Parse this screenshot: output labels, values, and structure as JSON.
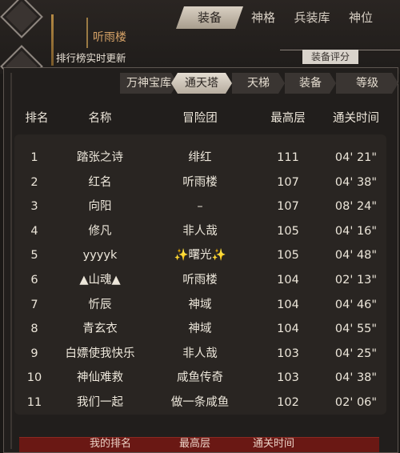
{
  "header": {
    "guild_name": "听雨楼",
    "rank_live_text": "排行榜实时更新",
    "score_button": "装备评分",
    "tabs": [
      {
        "label": "装备",
        "active": true
      },
      {
        "label": "神格",
        "active": false
      },
      {
        "label": "兵装库",
        "active": false
      },
      {
        "label": "神位",
        "active": false
      }
    ]
  },
  "subtabs": [
    {
      "label": "万神宝库",
      "active": false
    },
    {
      "label": "通天塔",
      "active": true
    },
    {
      "label": "天梯",
      "active": false
    },
    {
      "label": "装备",
      "active": false
    },
    {
      "label": "等级",
      "active": false
    }
  ],
  "table": {
    "headers": [
      "排名",
      "名称",
      "冒险团",
      "最高层",
      "通关时间"
    ],
    "rows": [
      {
        "rank": "1",
        "name": "踏张之诗",
        "guild": "绯红",
        "floor": "111",
        "time": "04' 21\""
      },
      {
        "rank": "2",
        "name": "红名",
        "guild": "听雨楼",
        "floor": "107",
        "time": "04' 38\""
      },
      {
        "rank": "3",
        "name": "向阳",
        "guild": "–",
        "floor": "107",
        "time": "08' 24\""
      },
      {
        "rank": "4",
        "name": "修凡",
        "guild": "非人哉",
        "floor": "105",
        "time": "04' 16\""
      },
      {
        "rank": "5",
        "name": "yyyyk",
        "guild": "✨曙光✨",
        "floor": "105",
        "time": "04' 48\""
      },
      {
        "rank": "6",
        "name": "▲山魂▲",
        "guild": "听雨楼",
        "floor": "104",
        "time": "02' 13\""
      },
      {
        "rank": "7",
        "name": "忻辰",
        "guild": "神域",
        "floor": "104",
        "time": "04' 46\""
      },
      {
        "rank": "8",
        "name": "青玄衣",
        "guild": "神域",
        "floor": "104",
        "time": "04' 55\""
      },
      {
        "rank": "9",
        "name": "白嫖使我快乐",
        "guild": "非人哉",
        "floor": "103",
        "time": "04' 25\""
      },
      {
        "rank": "10",
        "name": "神仙难救",
        "guild": "咸鱼传奇",
        "floor": "103",
        "time": "04' 38\""
      },
      {
        "rank": "11",
        "name": "我们一起",
        "guild": "做一条咸鱼",
        "floor": "102",
        "time": "02' 06\""
      }
    ]
  },
  "my_rank_bar": {
    "rank_label": "我的排名",
    "floor_label": "最高层",
    "time_label": "通关时间"
  },
  "colors": {
    "accent_gold": "#d8a468",
    "bar_red": "#6a1814",
    "panel_bg": "#211e1c"
  }
}
